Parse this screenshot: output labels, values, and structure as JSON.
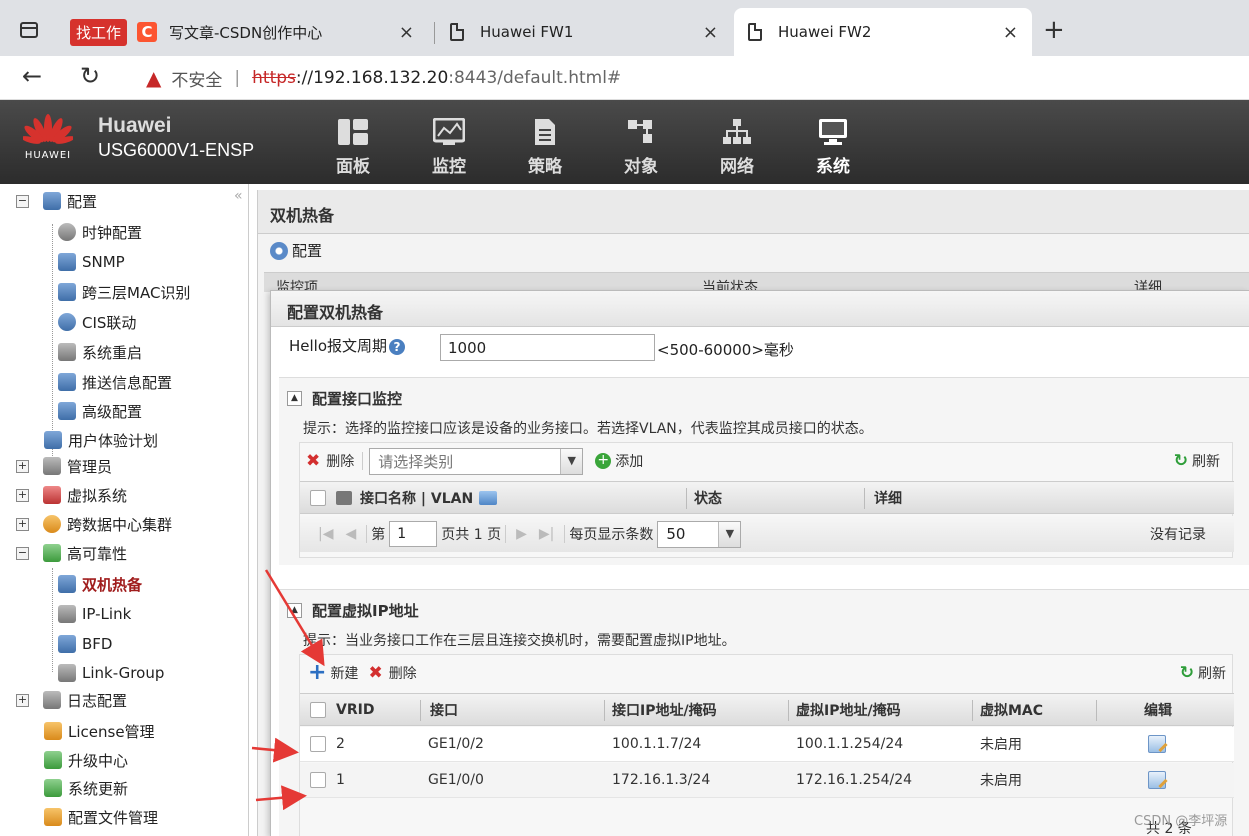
{
  "browser": {
    "tabs": [
      {
        "badge": "找工作",
        "title": "写文章-CSDN创作中心",
        "close": "×"
      },
      {
        "title": "Huawei FW1",
        "close": "×"
      },
      {
        "title": "Huawei FW2",
        "close": "×"
      }
    ],
    "new_tab": "+",
    "nav_back": "←",
    "nav_reload": "↻",
    "insecure_label": "不安全",
    "url_scheme": "https",
    "url_host": "://192.168.132.20",
    "url_rest": ":8443/default.html#"
  },
  "header": {
    "logo_text": "HUAWEI",
    "brand": "Huawei",
    "model": "USG6000V1-ENSP",
    "nav": [
      "面板",
      "监控",
      "策略",
      "对象",
      "网络",
      "系统"
    ],
    "active_nav": "系统"
  },
  "sidebar": {
    "collapse": "«",
    "items": [
      {
        "label": "配置",
        "toggle": "−",
        "level": 0
      },
      {
        "label": "时钟配置",
        "level": 1
      },
      {
        "label": "SNMP",
        "level": 1
      },
      {
        "label": "跨三层MAC识别",
        "level": 1
      },
      {
        "label": "CIS联动",
        "level": 1
      },
      {
        "label": "系统重启",
        "level": 1
      },
      {
        "label": "推送信息配置",
        "level": 1
      },
      {
        "label": "高级配置",
        "level": 1
      },
      {
        "label": "用户体验计划",
        "level": 0
      },
      {
        "label": "管理员",
        "toggle": "+",
        "level": 0
      },
      {
        "label": "虚拟系统",
        "toggle": "+",
        "level": 0
      },
      {
        "label": "跨数据中心集群",
        "toggle": "+",
        "level": 0
      },
      {
        "label": "高可靠性",
        "toggle": "−",
        "level": 0
      },
      {
        "label": "双机热备",
        "level": 1,
        "current": true
      },
      {
        "label": "IP-Link",
        "level": 1
      },
      {
        "label": "BFD",
        "level": 1
      },
      {
        "label": "Link-Group",
        "level": 1
      },
      {
        "label": "日志配置",
        "toggle": "+",
        "level": 0
      },
      {
        "label": "License管理",
        "level": 0
      },
      {
        "label": "升级中心",
        "level": 0
      },
      {
        "label": "系统更新",
        "level": 0
      },
      {
        "label": "配置文件管理",
        "level": 0
      }
    ]
  },
  "main": {
    "title": "双机热备",
    "config_label": "配置",
    "bg_cols": [
      "监控项",
      "当前状态",
      "详细"
    ]
  },
  "dialog": {
    "title": "配置双机热备",
    "hello_label": "Hello报文周期",
    "help": "?",
    "hello_value": "1000",
    "hello_hint": "<500-60000>毫秒",
    "iface_section": {
      "toggle": "▲",
      "title": "配置接口监控",
      "tip": "提示：选择的监控接口应该是设备的业务接口。若选择VLAN，代表监控其成员接口的状态。",
      "delete": "删除",
      "select_placeholder": "请选择类别",
      "add": "添加",
      "refresh": "刷新",
      "cols": [
        "接口名称 | VLAN",
        "状态",
        "详细"
      ],
      "pager": {
        "first": "|◀",
        "prev": "◀",
        "page_prefix": "第",
        "page": "1",
        "page_suffix": "页共 1 页",
        "next": "▶",
        "last": "▶|",
        "per_page_label": "每页显示条数",
        "per_page": "50",
        "no_records": "没有记录"
      }
    },
    "vip_section": {
      "toggle": "▲",
      "title": "配置虚拟IP地址",
      "tip": "提示：当业务接口工作在三层且连接交换机时，需要配置虚拟IP地址。",
      "new": "新建",
      "delete": "删除",
      "refresh": "刷新",
      "cols": [
        "VRID",
        "接口",
        "接口IP地址/掩码",
        "虚拟IP地址/掩码",
        "虚拟MAC",
        "编辑"
      ],
      "rows": [
        {
          "vrid": "2",
          "iface": "GE1/0/2",
          "ip": "100.1.1.7/24",
          "vip": "100.1.1.254/24",
          "vmac": "未启用"
        },
        {
          "vrid": "1",
          "iface": "GE1/0/0",
          "ip": "172.16.1.3/24",
          "vip": "172.16.1.254/24",
          "vmac": "未启用"
        }
      ],
      "total": "共 2 条"
    }
  },
  "watermark": "CSDN @李坪源",
  "colors": {
    "accent_red": "#a01c1c",
    "header_bg": "#333333",
    "annotation_arrow": "#e53935"
  }
}
